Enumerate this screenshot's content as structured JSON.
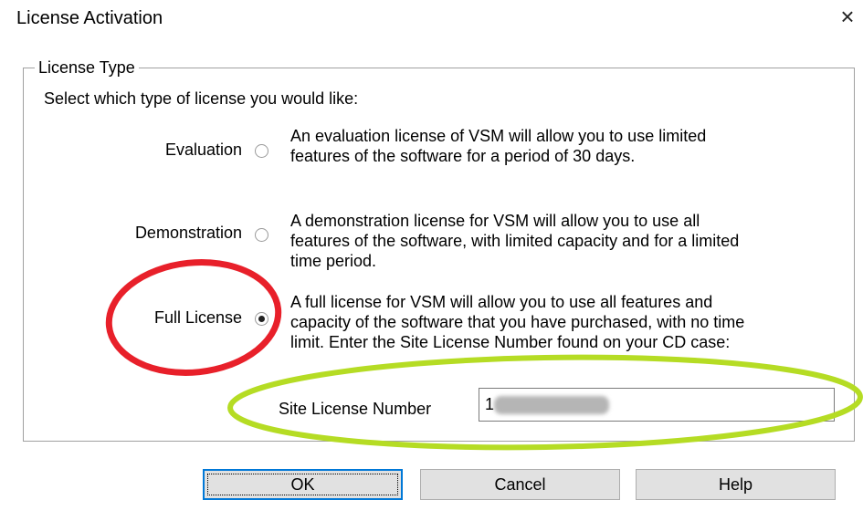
{
  "dialog": {
    "title": "License Activation",
    "close_glyph": "×"
  },
  "license_type": {
    "legend": "License Type",
    "instruction": "Select which type of license you would like:",
    "options": [
      {
        "label": "Evaluation",
        "checked": false,
        "description": [
          "An evaluation license of VSM will allow you to use limited",
          "features of the software for a period of 30 days."
        ]
      },
      {
        "label": "Demonstration",
        "checked": false,
        "description": [
          "A demonstration license for VSM will allow you to use all",
          "features of the software, with limited capacity and for a limited",
          "time period."
        ]
      },
      {
        "label": "Full License",
        "checked": true,
        "description": [
          "A full license for VSM will allow you to use all features and",
          "capacity of the software that you have purchased, with no time",
          "limit. Enter the Site License Number found on your CD case:"
        ]
      }
    ],
    "site_license": {
      "label": "Site License Number",
      "value": "1"
    }
  },
  "buttons": {
    "ok": "OK",
    "cancel": "Cancel",
    "help": "Help"
  },
  "annotations": {
    "full_license_circle_color": "#e8202a",
    "site_license_ellipse_color": "#b5dc24"
  }
}
